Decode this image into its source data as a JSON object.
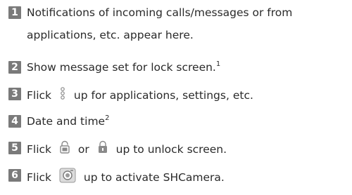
{
  "items": [
    {
      "number": "1",
      "line1": "Notifications of incoming calls/messages or from",
      "line2": "applications, etc. appear here."
    },
    {
      "number": "2",
      "text": "Show message set for lock screen.",
      "footnote": "1"
    },
    {
      "number": "3",
      "before": "Flick",
      "icon": "dots-vertical-icon",
      "after": "up for applications, settings, etc."
    },
    {
      "number": "4",
      "text": "Date and time",
      "footnote": "2"
    },
    {
      "number": "5",
      "before": "Flick",
      "icon1": "lock-open-icon",
      "middle": "or",
      "icon2": "lock-closed-icon",
      "after": "up to unlock screen."
    },
    {
      "number": "6",
      "before": "Flick",
      "icon": "camera-icon",
      "after": "up to activate SHCamera."
    }
  ],
  "colors": {
    "badge": "#7a7a7a",
    "text": "#2a2a2a",
    "icon": "#8a8a8a"
  }
}
